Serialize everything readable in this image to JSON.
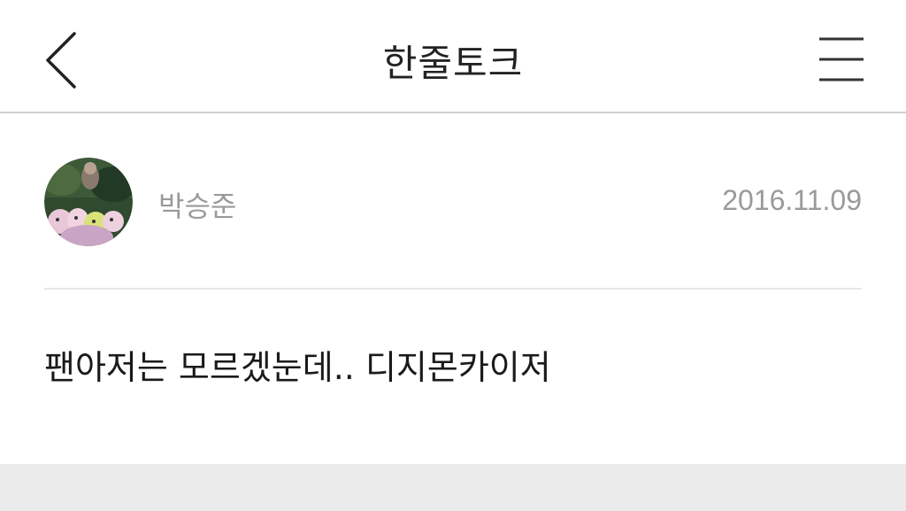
{
  "header": {
    "title": "한줄토크",
    "back_icon": "chevron-left-icon",
    "menu_icon": "hamburger-menu-icon"
  },
  "post": {
    "author": "박승준",
    "date": "2016.11.09",
    "body": "팬아저는 모르겠눈데.. 디지몬카이저",
    "avatar_icon": "avatar-image"
  },
  "colors": {
    "text_primary": "#1a1a1a",
    "text_secondary": "#9a9a9a",
    "divider": "#e6e6e6",
    "footer_band": "#ebebeb"
  }
}
